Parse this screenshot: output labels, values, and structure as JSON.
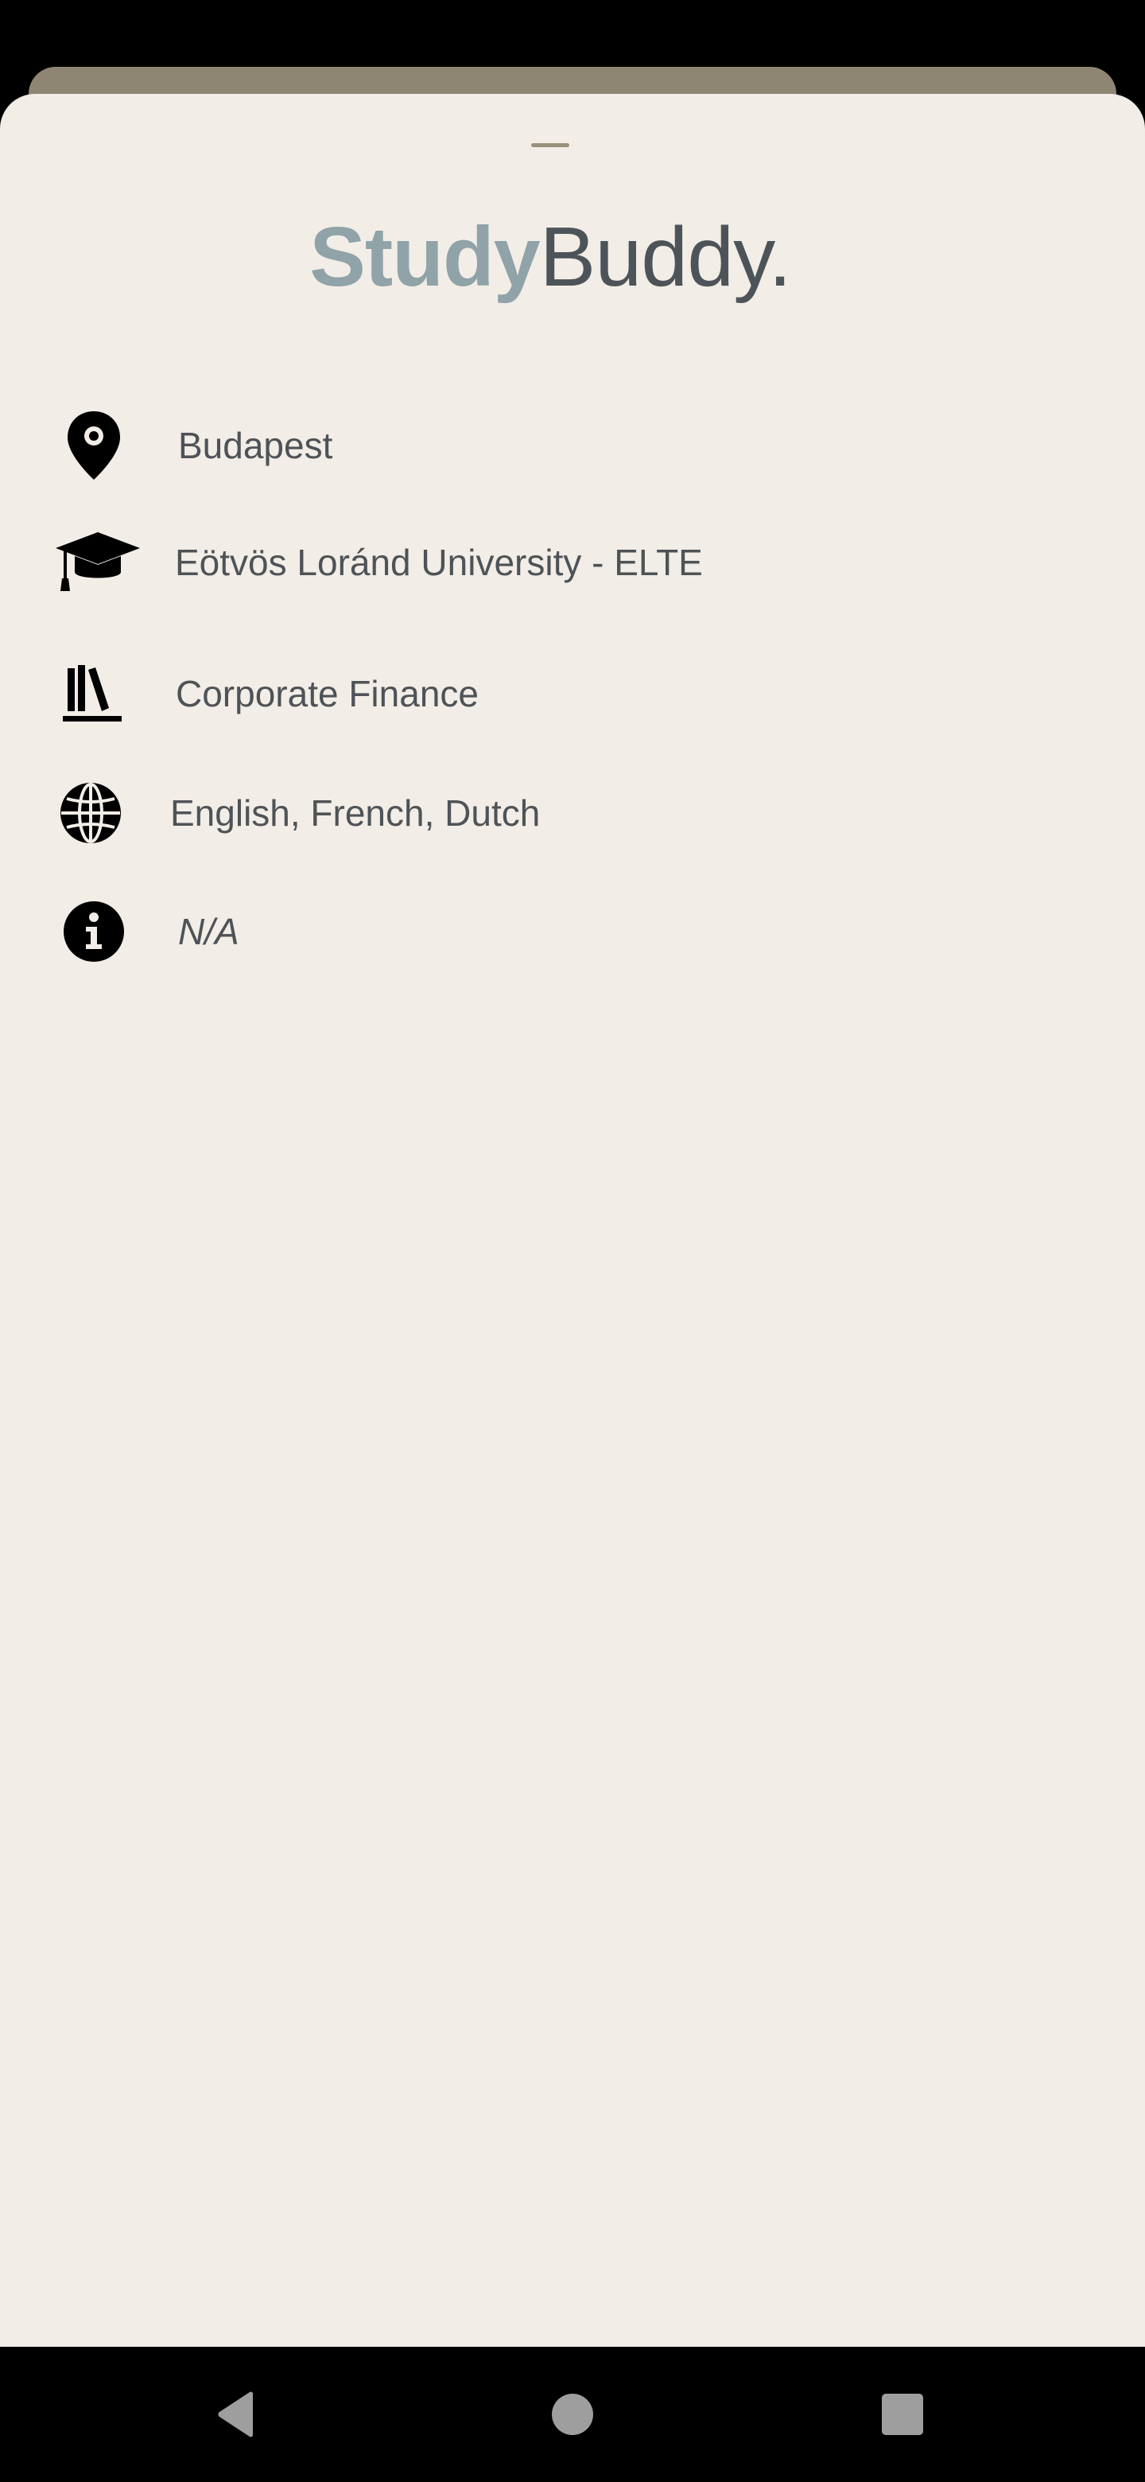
{
  "app": {
    "logo_part1": "Study",
    "logo_part2": "Buddy."
  },
  "profile": {
    "items": [
      {
        "icon": "location-pin-icon",
        "text": "Budapest"
      },
      {
        "icon": "graduation-cap-icon",
        "text": "Eötvös Loránd University - ELTE"
      },
      {
        "icon": "books-icon",
        "text": "Corporate Finance"
      },
      {
        "icon": "globe-icon",
        "text": "English, French, Dutch"
      },
      {
        "icon": "info-icon",
        "text": "N/A"
      }
    ]
  },
  "navigation": {
    "buttons": [
      "back-icon",
      "home-icon",
      "recents-icon"
    ]
  },
  "colors": {
    "sheet_background": "#f2ede6",
    "behind_card": "#8e8672",
    "logo_accent": "#8fa3a8",
    "logo_dark": "#4d5459",
    "body_text": "#4e5357",
    "system_bar": "#000000"
  }
}
